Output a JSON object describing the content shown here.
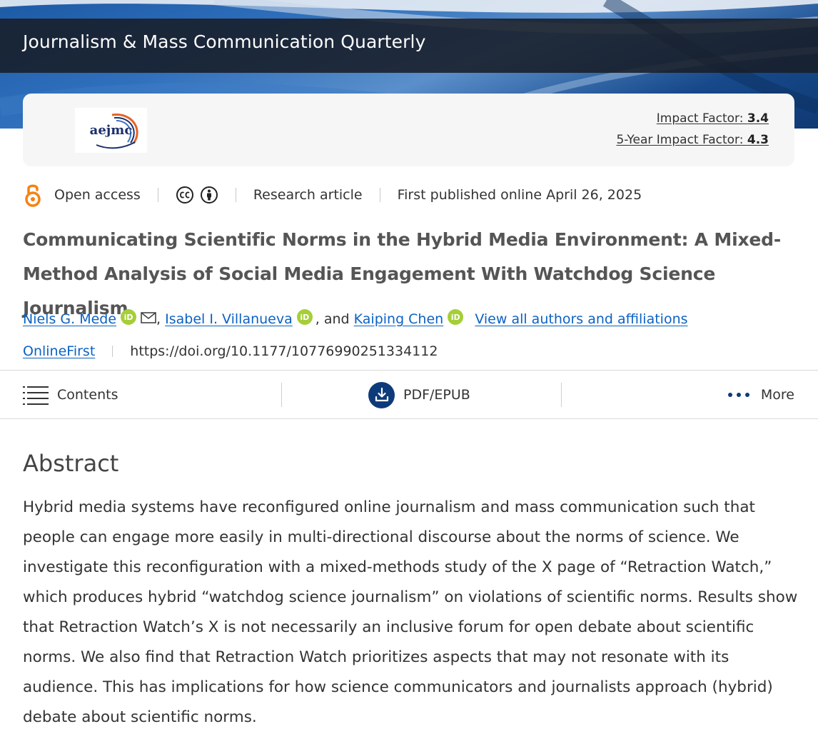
{
  "journal": {
    "title": "Journalism & Mass Communication Quarterly",
    "logo_text": "aejmc"
  },
  "metrics": {
    "impact_label": "Impact Factor:",
    "impact_value": "3.4",
    "five_year_label": "5-Year Impact Factor:",
    "five_year_value": "4.3"
  },
  "meta": {
    "access": "Open access",
    "type": "Research article",
    "published": "First published online April 26, 2025"
  },
  "article": {
    "title": "Communicating Scientific Norms in the Hybrid Media Environment: A Mixed-Method Analysis of Social Media Engagement With Watchdog Science Journalism"
  },
  "authors": {
    "list": [
      "Niels G. Mede",
      "Isabel I. Villanueva",
      "Kaiping Chen"
    ],
    "sep_comma": ",",
    "sep_and": ", and",
    "view_all": "View all authors and affiliations",
    "orcid_label": "iD"
  },
  "doi": {
    "status": "OnlineFirst",
    "url": "https://doi.org/10.1177/10776990251334112"
  },
  "toolbar": {
    "contents": "Contents",
    "pdf": "PDF/EPUB",
    "more": "More"
  },
  "abstract": {
    "heading": "Abstract",
    "text": "Hybrid media systems have reconfigured online journalism and mass communication such that people can engage more easily in multi-directional discourse about the norms of science. We investigate this reconfiguration with a mixed-methods study of the X page of “Retraction Watch,” which produces hybrid “watchdog science journalism” on violations of scientific norms. Results show that Retraction Watch’s X is not necessarily an inclusive forum for open debate about scientific norms. We also find that Retraction Watch prioritizes aspects that may not resonate with its audience. This has implications for how science communicators and journalists approach (hybrid) debate about scientific norms."
  },
  "colors": {
    "link": "#0b62c4",
    "orcid": "#a6ce39",
    "open_access": "#f68212",
    "brand_navy": "#0d3b7a"
  },
  "icons": {
    "open_access": "open-access-lock-icon",
    "cc": "creative-commons-icon",
    "by": "attribution-icon",
    "mail": "mail-icon",
    "contents": "hamburger-menu-icon",
    "pdf": "download-icon",
    "more": "more-dots-icon"
  }
}
